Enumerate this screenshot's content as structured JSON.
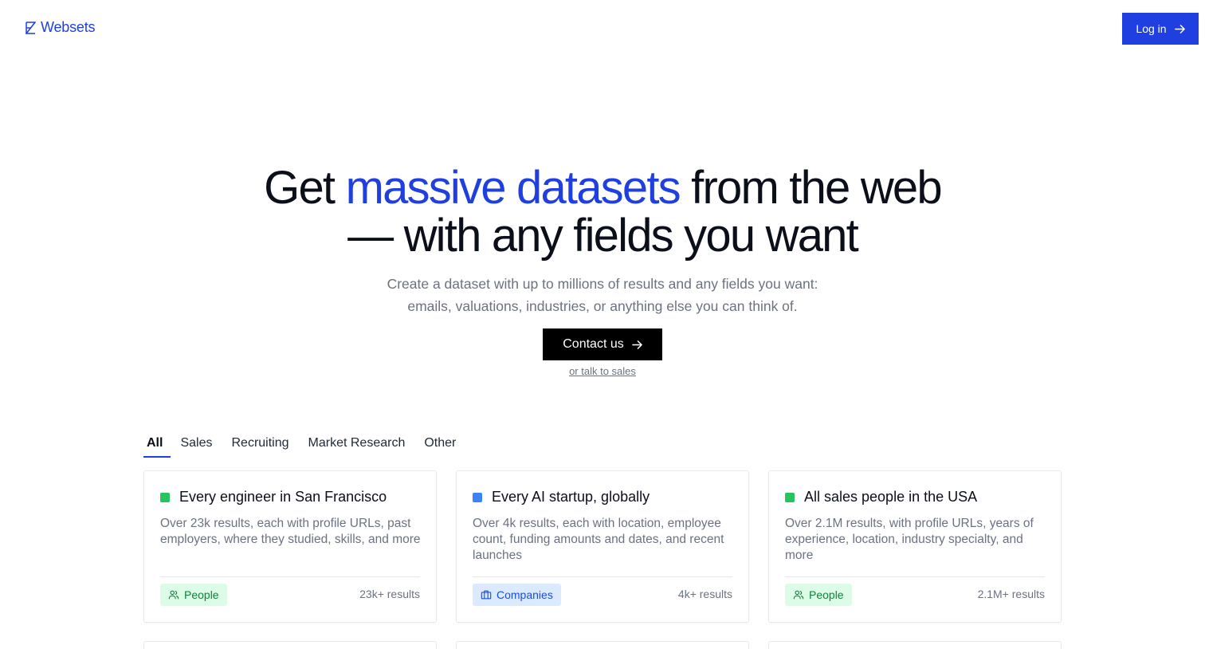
{
  "header": {
    "logo_text": "Websets",
    "login_label": "Log in"
  },
  "hero": {
    "line1_prefix": "Get ",
    "line1_accent": "massive datasets",
    "line1_suffix": " from the web",
    "line2": "— with any fields you want",
    "subtitle_line1": "Create a dataset with up to millions of results and any fields you want:",
    "subtitle_line2": "emails, valuations, industries, or anything else you can think of.",
    "cta_label": "Contact us",
    "sales_link": "or talk to sales"
  },
  "tabs": [
    {
      "label": "All",
      "active": true
    },
    {
      "label": "Sales",
      "active": false
    },
    {
      "label": "Recruiting",
      "active": false
    },
    {
      "label": "Market Research",
      "active": false
    },
    {
      "label": "Other",
      "active": false
    }
  ],
  "cards": [
    {
      "title": "Every engineer in San Francisco",
      "description": "Over 23k results, each with profile URLs, past employers, where they studied, skills, and more",
      "badge": "People",
      "badge_icon": "people-icon",
      "count": "23k+ results",
      "color": "#22c55e"
    },
    {
      "title": "Every AI startup, globally",
      "description": "Over 4k results, each with location, employee count, funding amounts and dates, and recent launches",
      "badge": "Companies",
      "badge_icon": "briefcase-icon",
      "count": "4k+ results",
      "color": "#3b82f6"
    },
    {
      "title": "All sales people in the USA",
      "description": "Over 2.1M results, with profile URLs, years of experience, location, industry specialty, and more",
      "badge": "People",
      "badge_icon": "people-icon",
      "count": "2.1M+ results",
      "color": "#22c55e"
    }
  ],
  "colors": {
    "accent": "#1f3fe0",
    "text": "#0b0f1a",
    "muted": "#6b7280"
  }
}
